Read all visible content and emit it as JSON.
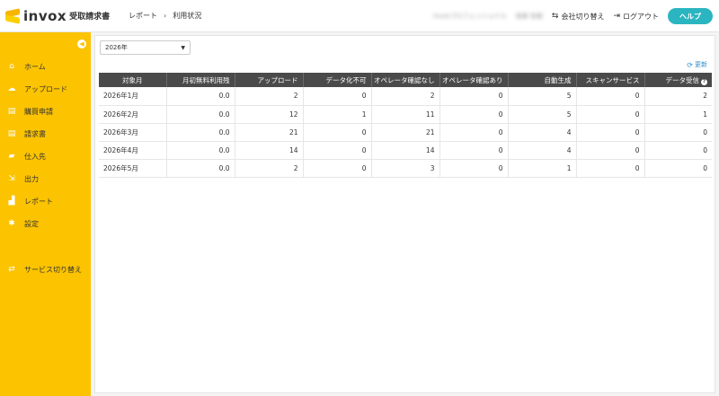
{
  "header": {
    "logo_text": "invox",
    "logo_sub": "受取請求書",
    "breadcrumb": [
      "レポート",
      "利用状況"
    ],
    "company_name_blurred": "invoxプロフェッショナル",
    "user_name_blurred": "後藤 佑樹",
    "switch_company_label": "会社切り替え",
    "logout_label": "ログアウト",
    "help_label": "ヘルプ"
  },
  "sidebar": {
    "items": [
      {
        "label": "ホーム",
        "icon": "home-icon"
      },
      {
        "label": "アップロード",
        "icon": "cloud-upload-icon"
      },
      {
        "label": "購買申請",
        "icon": "document-icon"
      },
      {
        "label": "請求書",
        "icon": "document-icon"
      },
      {
        "label": "仕入先",
        "icon": "truck-icon"
      },
      {
        "label": "出力",
        "icon": "export-icon"
      },
      {
        "label": "レポート",
        "icon": "chart-icon"
      },
      {
        "label": "設定",
        "icon": "gear-icon"
      },
      {
        "label": "サービス切り替え",
        "icon": "switch-icon"
      }
    ]
  },
  "filter": {
    "year_value": "2026年"
  },
  "refresh_label": "更新",
  "table": {
    "headers": [
      "対象月",
      "月初無料利用残",
      "アップロード",
      "データ化不可",
      "オペレータ確認なし",
      "オペレータ確認あり",
      "自動生成",
      "スキャンサービス",
      "データ受信"
    ],
    "rows": [
      [
        "2026年1月",
        "0.0",
        "2",
        "0",
        "2",
        "0",
        "5",
        "0",
        "2"
      ],
      [
        "2026年2月",
        "0.0",
        "12",
        "1",
        "11",
        "0",
        "5",
        "0",
        "1"
      ],
      [
        "2026年3月",
        "0.0",
        "21",
        "0",
        "21",
        "0",
        "4",
        "0",
        "0"
      ],
      [
        "2026年4月",
        "0.0",
        "14",
        "0",
        "14",
        "0",
        "4",
        "0",
        "0"
      ],
      [
        "2026年5月",
        "0.0",
        "2",
        "0",
        "3",
        "0",
        "1",
        "0",
        "0"
      ]
    ]
  },
  "colors": {
    "sidebar_bg": "#fcc300",
    "header_table_bg": "#4a4a4a",
    "help_button": "#2bb5c0",
    "link": "#2b8dc6"
  }
}
